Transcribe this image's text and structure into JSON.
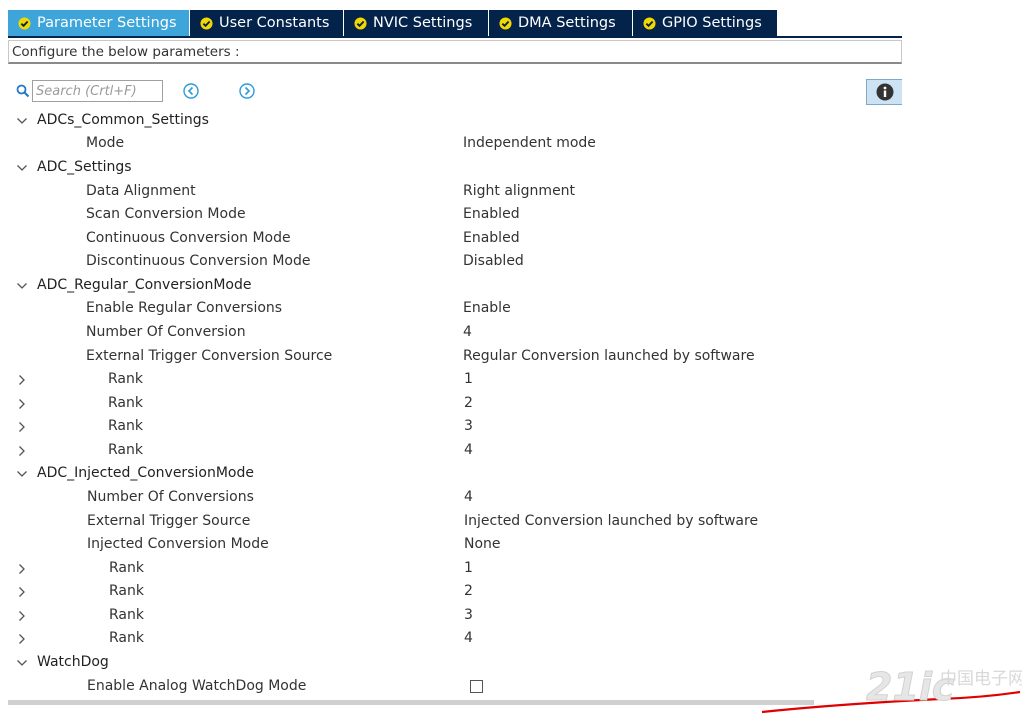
{
  "tabs": [
    {
      "label": "Parameter Settings",
      "active": true
    },
    {
      "label": "User Constants",
      "active": false
    },
    {
      "label": "NVIC Settings",
      "active": false
    },
    {
      "label": "DMA Settings",
      "active": false
    },
    {
      "label": "GPIO Settings",
      "active": false
    }
  ],
  "config_header": "Configure the below parameters :",
  "search": {
    "placeholder": "Search (Crtl+F)",
    "value": ""
  },
  "groups": {
    "common": {
      "name": "ADCs_Common_Settings",
      "params": [
        {
          "label": "Mode",
          "value": "Independent mode"
        }
      ]
    },
    "adc": {
      "name": "ADC_Settings",
      "params": [
        {
          "label": "Data Alignment",
          "value": "Right alignment"
        },
        {
          "label": "Scan Conversion Mode",
          "value": "Enabled"
        },
        {
          "label": "Continuous Conversion Mode",
          "value": "Enabled"
        },
        {
          "label": "Discontinuous Conversion Mode",
          "value": "Disabled"
        }
      ]
    },
    "regular": {
      "name": "ADC_Regular_ConversionMode",
      "params": [
        {
          "label": "Enable Regular Conversions",
          "value": "Enable"
        },
        {
          "label": "Number Of Conversion",
          "value": "4"
        },
        {
          "label": "External Trigger Conversion Source",
          "value": "Regular Conversion launched by software"
        }
      ],
      "ranks": [
        {
          "label": "Rank",
          "value": "1"
        },
        {
          "label": "Rank",
          "value": "2"
        },
        {
          "label": "Rank",
          "value": "3"
        },
        {
          "label": "Rank",
          "value": "4"
        }
      ]
    },
    "injected": {
      "name": "ADC_Injected_ConversionMode",
      "params": [
        {
          "label": "Number Of Conversions",
          "value": "4"
        },
        {
          "label": "External Trigger Source",
          "value": "Injected Conversion launched by software"
        },
        {
          "label": "Injected Conversion Mode",
          "value": "None"
        }
      ],
      "ranks": [
        {
          "label": "Rank",
          "value": "1"
        },
        {
          "label": "Rank",
          "value": "2"
        },
        {
          "label": "Rank",
          "value": "3"
        },
        {
          "label": "Rank",
          "value": "4"
        }
      ]
    },
    "watchdog": {
      "name": "WatchDog",
      "params": [
        {
          "label": "Enable Analog WatchDog Mode",
          "checked": false
        }
      ]
    }
  },
  "watermark": {
    "text": "21ic中国电子网",
    "color": "#cccccc"
  },
  "colors": {
    "tab_active": "#3da5d9",
    "tab_inactive": "#03234b",
    "check_icon": "#f2d700",
    "annotation": "#e00000"
  }
}
